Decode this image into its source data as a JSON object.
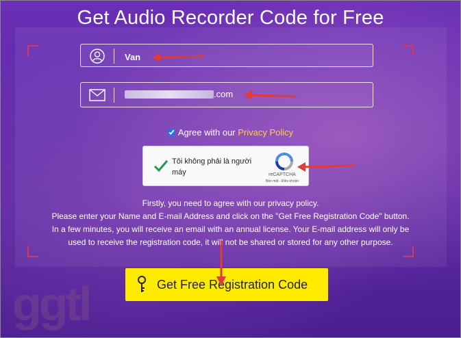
{
  "page": {
    "title": "Get Audio Recorder Code for Free"
  },
  "form": {
    "name_value": "Van",
    "email_suffix": ".com",
    "agree_text": "Agree with our",
    "privacy_link": "Privacy Policy",
    "agree_checked": true
  },
  "captcha": {
    "label": "Tôi không phải là người máy",
    "brand": "reCAPTCHA",
    "terms": "Bảo mật - Điều khoản"
  },
  "info": {
    "line1": "Firstly, you need to agree with our privacy policy.",
    "line2": "Please enter your Name and E-mail Address and click on the \"Get Free Registration Code\" button.",
    "line3": "In a few minutes, you will receive an email with an annual license. Your E-mail address will only be",
    "line4": "used to receive the registration code, it will not be shared or stored for any other purpose."
  },
  "cta": {
    "label": "Get Free Registration Code"
  },
  "watermark": "ggtl",
  "colors": {
    "background": "#5b27a6",
    "accent_yellow": "#ffeb00",
    "link_yellow": "#ffd42a",
    "annotation_red": "#e03a3a",
    "corner_red": "#d9365f",
    "check_green": "#1e9b4f"
  },
  "icons": [
    "user-icon",
    "envelope-icon",
    "checkmark-icon",
    "recaptcha-icon",
    "key-icon",
    "arrow-annotation"
  ]
}
